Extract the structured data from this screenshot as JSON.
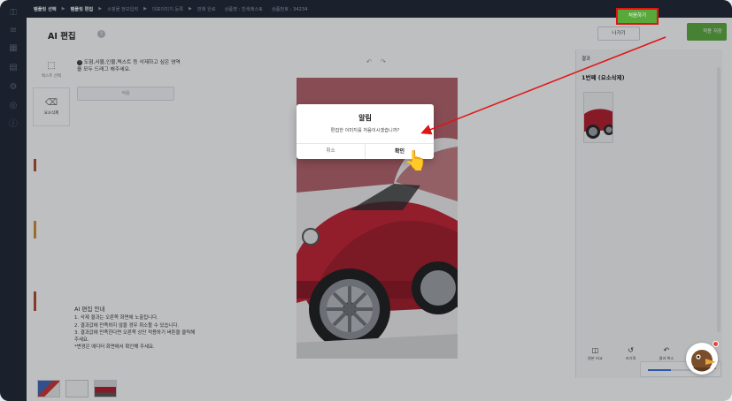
{
  "steps": {
    "items": [
      {
        "label": "템플릿 선택",
        "active": true
      },
      {
        "label": "템플릿 편집",
        "active": true
      },
      {
        "label": "소핑몰 정보입력",
        "active": false
      },
      {
        "label": "대표이미지 등록",
        "active": false
      },
      {
        "label": "판매 완료",
        "active": false
      }
    ],
    "product_name_label": "상품명 : 빈색레스토",
    "product_no_label": "상품번호 : 34234"
  },
  "workspace": {
    "title": "AI 편집",
    "help_glyph": "?",
    "tools": [
      {
        "label": "텍스트 선택",
        "icon": "text-select-icon"
      },
      {
        "label": "요소삭제",
        "icon": "eraser-icon"
      }
    ],
    "instruction": "도형,사물,인물,텍스트 등 삭제하고 싶은 영역을 모두 드래그 해주세요.",
    "exec_button": "적용",
    "guide": {
      "heading": "AI 편집 안내",
      "lines": [
        "1. 삭제 결과는 오른쪽 화면에 노출됩니다.",
        "2. 결과값에 만족하지 않을 경우 취소할 수 있습니다.",
        "3. 결과값에 만족한다면 오른쪽 상단 적용하기 버튼을 클릭해 주세요.",
        "*변경은 에디터 화면에서 확인해 주세요."
      ]
    }
  },
  "header_buttons": {
    "out": "나가기",
    "start": "처음하기",
    "save": "적용 저장"
  },
  "right_panel": {
    "title": "결과",
    "subtitle": "1번째 (요소삭제)",
    "tools": [
      {
        "label": "원본 비교",
        "glyph": "◫",
        "icon": "compare-icon"
      },
      {
        "label": "초기화",
        "glyph": "↺",
        "icon": "reset-icon"
      },
      {
        "label": "결과 취소",
        "glyph": "↶",
        "icon": "undo-result-icon"
      },
      {
        "label": "결과 복구",
        "glyph": "↷",
        "icon": "redo-result-icon"
      }
    ]
  },
  "zoom": {
    "percent_label": "50%",
    "value": 0.5
  },
  "dialog": {
    "title": "알림",
    "message": "편집한 이미지를 처음이시겠습니까?",
    "cancel": "취소",
    "confirm": "확인"
  },
  "colors": {
    "rail": "#1d2433",
    "accent_green": "#58a83a",
    "highlight_red": "#e01515",
    "car_red": "#b31b2a"
  }
}
